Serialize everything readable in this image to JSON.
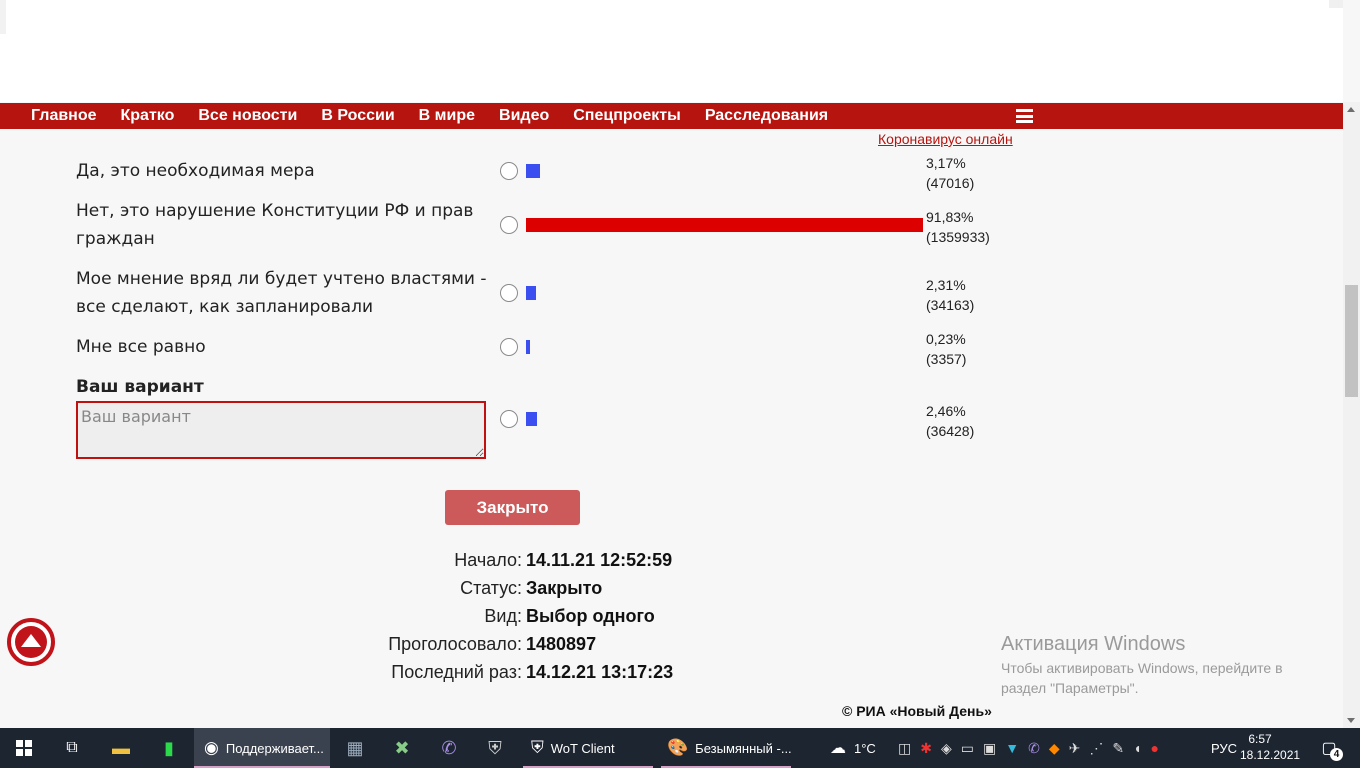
{
  "nav": {
    "items": [
      "Главное",
      "Кратко",
      "Все новости",
      "В России",
      "В мире",
      "Видео",
      "Спецпроекты",
      "Расследования"
    ],
    "corona_link": "Коронавирус онлайн"
  },
  "poll": {
    "options": [
      {
        "label": "Да, это необходимая мера",
        "percent": "3,17%",
        "votes": "(47016)",
        "share": 0.0317
      },
      {
        "label": "Нет, это нарушение Конституции РФ и прав граждан",
        "percent": "91,83%",
        "votes": "(1359933)",
        "share": 0.9183
      },
      {
        "label": "Мое мнение вряд ли будет учтено властями - все сделают, как запланировали",
        "percent": "2,31%",
        "votes": "(34163)",
        "share": 0.0231
      },
      {
        "label": "Мне все равно",
        "percent": "0,23%",
        "votes": "(3357)",
        "share": 0.0023
      }
    ],
    "own": {
      "title": "Ваш вариант",
      "placeholder": "Ваш вариант",
      "percent": "2,46%",
      "votes": "(36428)",
      "share": 0.0246
    },
    "close_button": "Закрыто",
    "info": [
      {
        "key": "Начало:",
        "value": "14.11.21 12:52:59"
      },
      {
        "key": "Статус:",
        "value": "Закрыто"
      },
      {
        "key": "Вид:",
        "value": "Выбор одного"
      },
      {
        "key": "Проголосовало:",
        "value": "1480897"
      },
      {
        "key": "Последний раз:",
        "value": "14.12.21 13:17:23"
      }
    ],
    "colors": {
      "top_bar": "#dd0000",
      "other_bar": "#3b4ef0"
    }
  },
  "windows_activation": {
    "title": "Активация Windows",
    "text": "Чтобы активировать Windows, перейдите в раздел \"Параметры\"."
  },
  "copyright": "© РИА «Новый День»",
  "taskbar": {
    "apps": [
      {
        "label": "Поддерживает..."
      },
      {
        "label": "WoT Client"
      },
      {
        "label": "Безымянный -..."
      }
    ],
    "weather": "1°C",
    "lang": "РУС",
    "time": "6:57",
    "date": "18.12.2021",
    "notifications": "4"
  }
}
